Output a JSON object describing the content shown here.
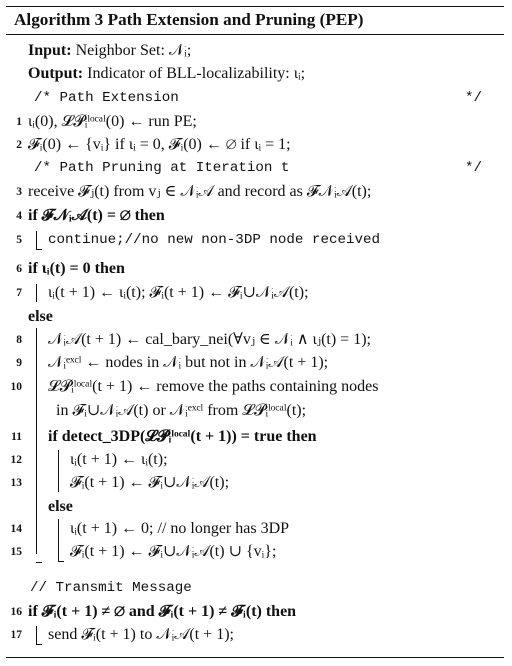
{
  "algorithm": {
    "title": "Algorithm 3 Path Extension and Pruning (PEP)",
    "input_label": "Input:",
    "input_text": "Neighbor Set: 𝒩ᵢ;",
    "output_label": "Output:",
    "output_text": "Indicator of BLL-localizability: ιᵢ;",
    "comment_path_extension": "/* Path Extension",
    "comment_close_1": "*/",
    "comment_path_pruning": "/* Path Pruning at Iteration t",
    "comment_close_2": "*/",
    "comment_transmit": "// Transmit Message",
    "lines": [
      {
        "num": "1",
        "text": "ιᵢ(0), 𝓛𝓟ᵢˡᵒᶜᵃˡ(0) ← run PE;"
      },
      {
        "num": "2",
        "text": "𝓕ᵢ(0) ← {vᵢ} if ιᵢ = 0, 𝓕ᵢ(0) ← ∅ if ιᵢ = 1;"
      },
      {
        "num": "3",
        "text": "receive 𝓕ⱼ(t) from vⱼ ∈ 𝒩ᵢ𝒜 and record as 𝓕𝒩ᵢ𝒜(t);"
      },
      {
        "num": "4",
        "text": "if 𝓕𝒩ᵢ𝒜(t) = ∅ then"
      },
      {
        "num": "5",
        "text": "continue;//no new non-3DP node received"
      },
      {
        "num": "6",
        "text": "if ιᵢ(t) = 0 then"
      },
      {
        "num": "7",
        "text": "ιᵢ(t + 1) ← ιᵢ(t); 𝓕ᵢ(t + 1) ← 𝓕ᵢ∪𝒩ᵢ𝒜(t);"
      },
      {
        "num": "",
        "text": "else"
      },
      {
        "num": "8",
        "text": "𝒩ᵢ𝒜(t + 1) ← cal_bary_nei(∀vⱼ ∈ 𝒩ᵢ ∧ ιⱼ(t) = 1);"
      },
      {
        "num": "9",
        "text": "𝒩ᵢᵉˣᶜˡ ← nodes in 𝒩ᵢ but not in 𝒩ᵢ𝒜(t + 1);"
      },
      {
        "num": "10",
        "text": "𝓛𝓟ᵢˡᵒᶜᵃˡ(t + 1) ← remove the paths containing nodes"
      },
      {
        "num": "",
        "text": "in 𝓕ᵢ∪𝒩ᵢ𝒜(t) or 𝒩ᵢᵉˣᶜˡ from 𝓛𝓟ᵢˡᵒᶜᵃˡ(t);"
      },
      {
        "num": "11",
        "text": "if detect_3DP(𝓛𝓟ᵢˡᵒᶜᵃˡ(t + 1)) = true then"
      },
      {
        "num": "12",
        "text": "ιᵢ(t + 1) ← ιᵢ(t);"
      },
      {
        "num": "13",
        "text": "𝓕ᵢ(t + 1) ← 𝓕ᵢ∪𝒩ᵢ𝒜(t);"
      },
      {
        "num": "",
        "text": "else"
      },
      {
        "num": "14",
        "text": "ιᵢ(t + 1) ← 0; // no longer has 3DP"
      },
      {
        "num": "15",
        "text": "𝓕ᵢ(t + 1) ← 𝓕ᵢ∪𝒩ᵢ𝒜(t) ∪ {vᵢ};"
      },
      {
        "num": "16",
        "text": "if 𝓕ᵢ(t + 1) ≠ ∅ and 𝓕ᵢ(t + 1) ≠ 𝓕ᵢ(t) then"
      },
      {
        "num": "17",
        "text": "send 𝓕ᵢ(t + 1) to 𝒩ᵢ𝒜(t + 1);"
      }
    ]
  }
}
